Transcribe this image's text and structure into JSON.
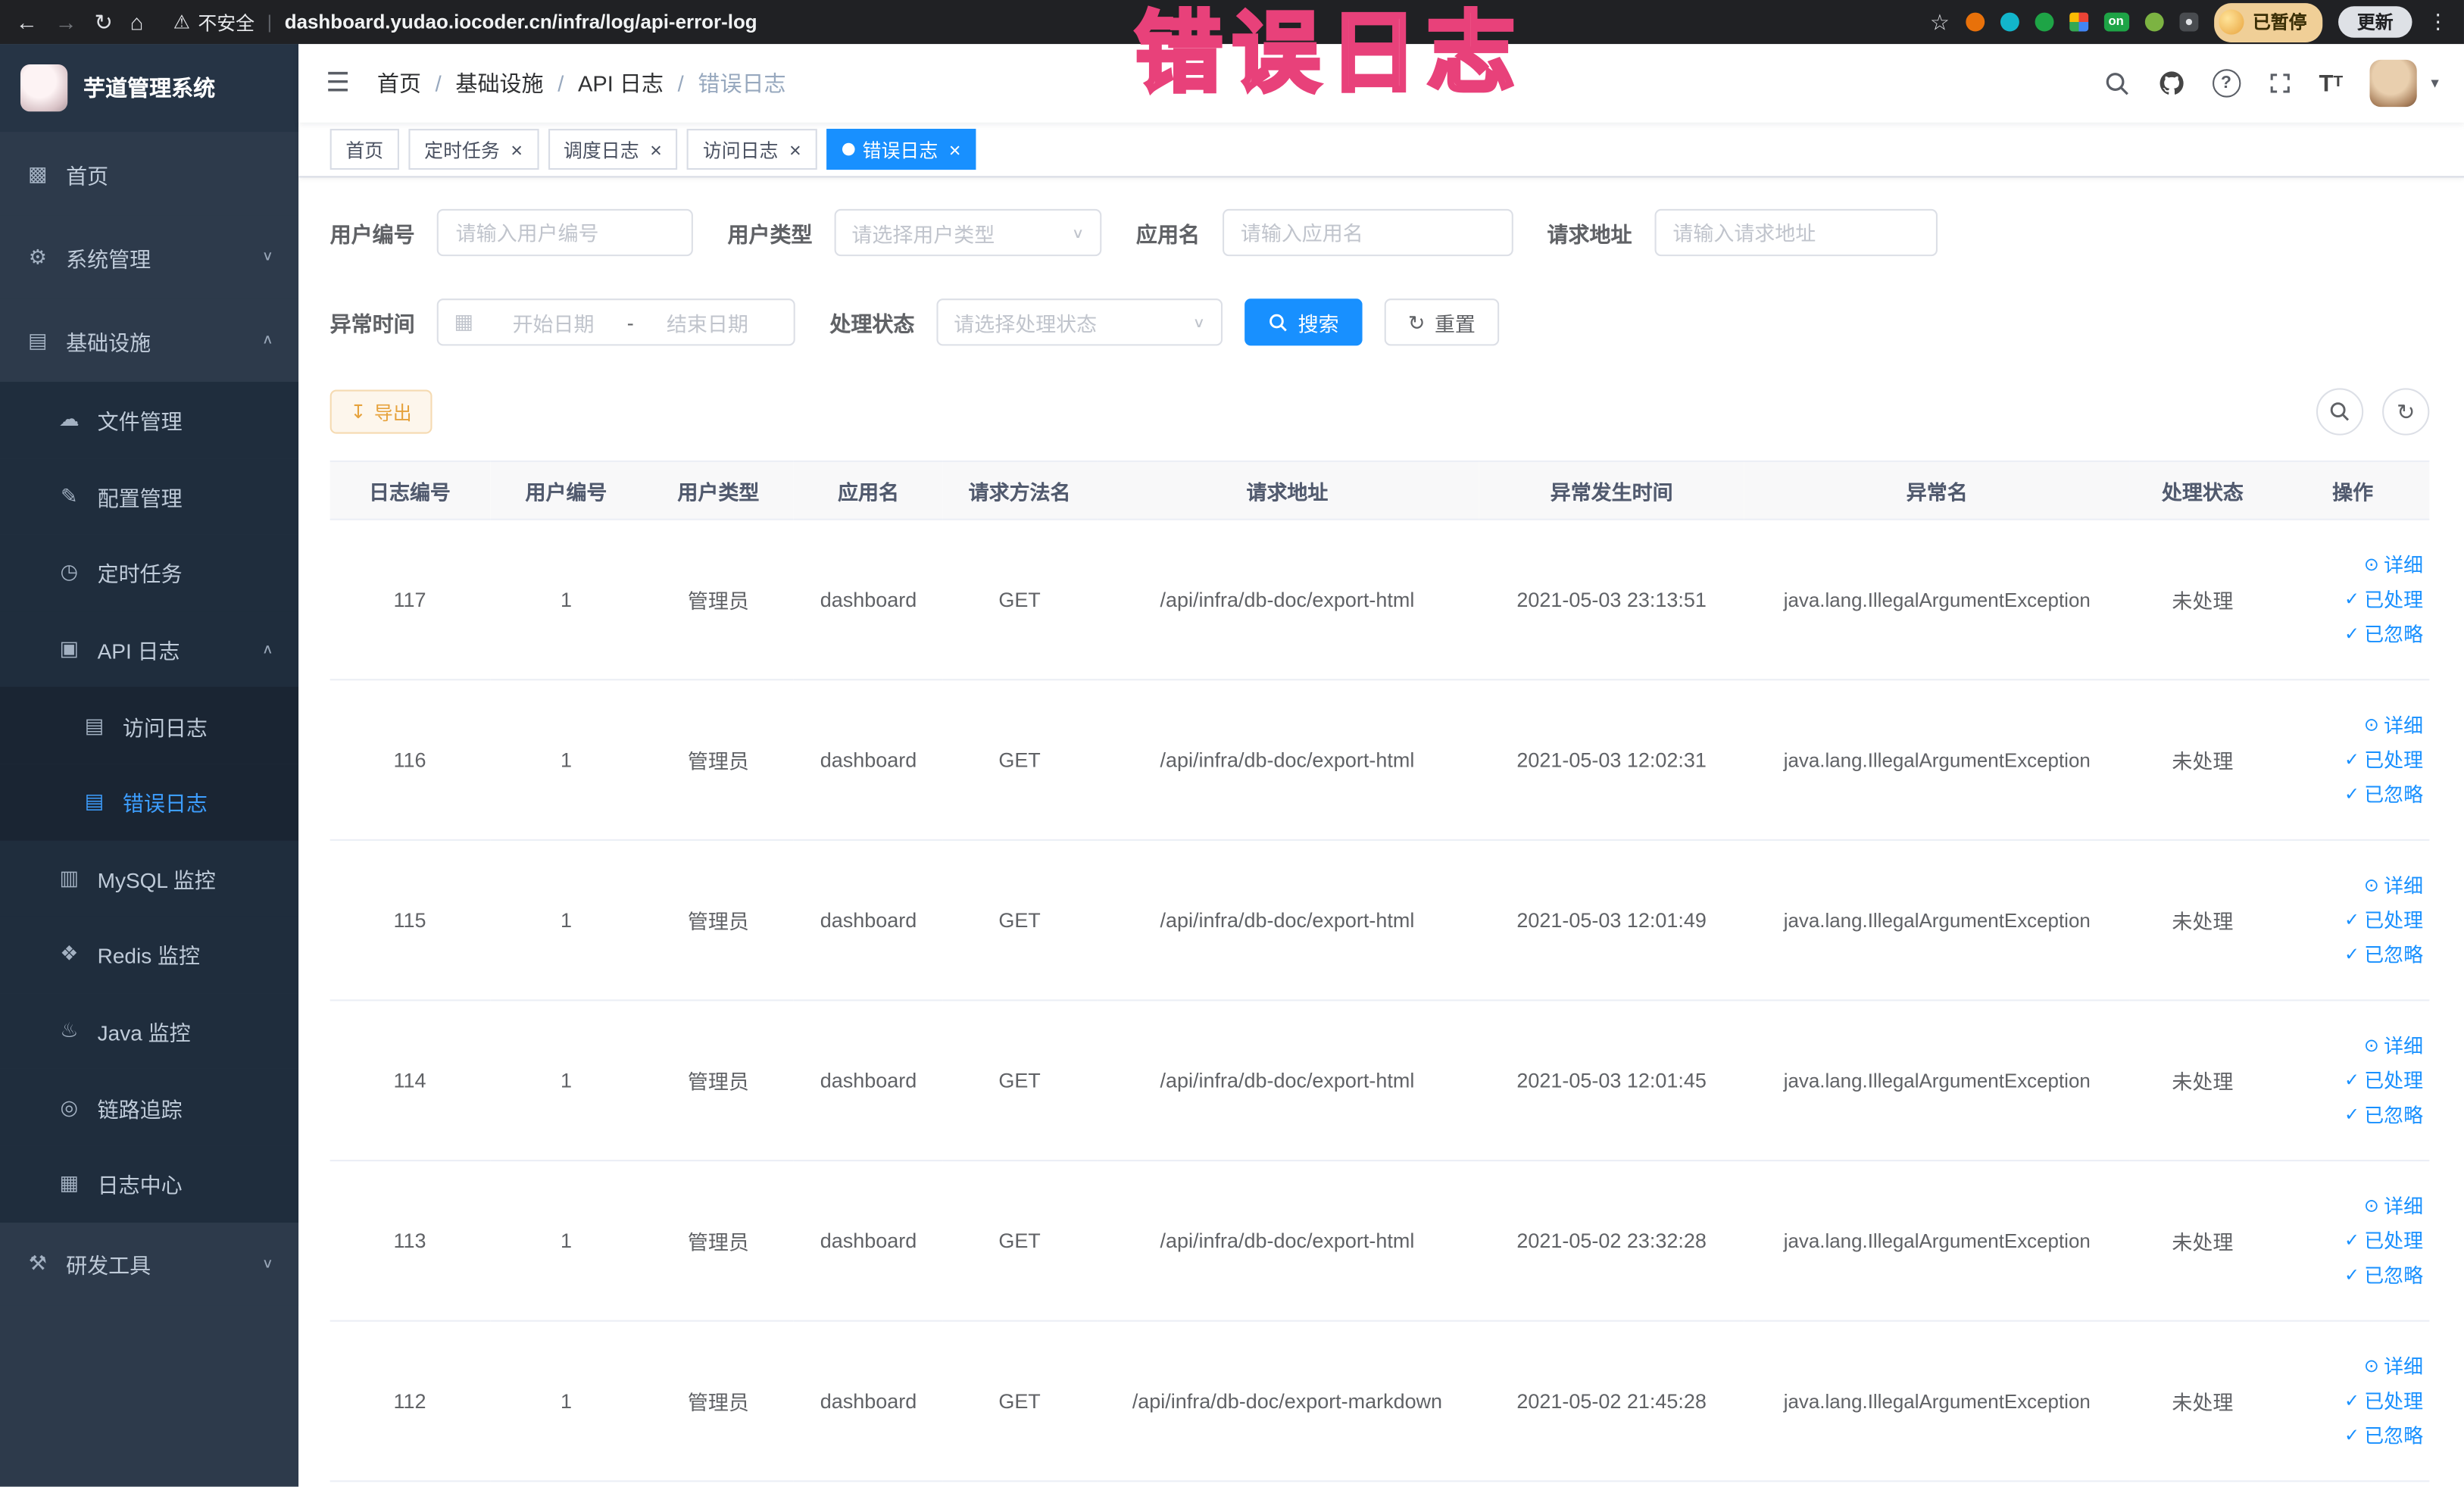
{
  "colors": {
    "accent": "#1890ff",
    "warning": "#e6a23c",
    "sidebar_bg": "#2d3a4b",
    "active_tab": "#1890ff"
  },
  "annotation": {
    "title": "错误日志"
  },
  "browser": {
    "security_label": "不安全",
    "url": "dashboard.yudao.iocoder.cn/infra/log/api-error-log",
    "extension_badge": "on",
    "profile_chip": "已暂停",
    "update_button": "更新"
  },
  "sidebar": {
    "logo_title": "芋道管理系统",
    "items": [
      {
        "name": "home",
        "label": "首页",
        "icon": "home-icon",
        "level": 0
      },
      {
        "name": "system-management",
        "label": "系统管理",
        "icon": "gear-icon",
        "level": 0,
        "chevron": "down"
      },
      {
        "name": "infrastructure",
        "label": "基础设施",
        "icon": "infrastructure-icon",
        "level": 0,
        "chevron": "up"
      },
      {
        "name": "file-management",
        "label": "文件管理",
        "icon": "cloud-icon",
        "level": 1
      },
      {
        "name": "config-management",
        "label": "配置管理",
        "icon": "edit-icon",
        "level": 1
      },
      {
        "name": "scheduled-jobs",
        "label": "定时任务",
        "icon": "timer-icon",
        "level": 1
      },
      {
        "name": "api-log",
        "label": "API 日志",
        "icon": "api-log-icon",
        "level": 1,
        "chevron": "up"
      },
      {
        "name": "access-log",
        "label": "访问日志",
        "icon": "access-log-icon",
        "level": 2
      },
      {
        "name": "error-log",
        "label": "错误日志",
        "icon": "error-log-icon",
        "level": 2,
        "active": true
      },
      {
        "name": "mysql-monitor",
        "label": "MySQL 监控",
        "icon": "mysql-icon",
        "level": 1
      },
      {
        "name": "redis-monitor",
        "label": "Redis 监控",
        "icon": "redis-icon",
        "level": 1
      },
      {
        "name": "java-monitor",
        "label": "Java 监控",
        "icon": "java-icon",
        "level": 1
      },
      {
        "name": "trace",
        "label": "链路追踪",
        "icon": "trace-icon",
        "level": 1
      },
      {
        "name": "log-center",
        "label": "日志中心",
        "icon": "log-center-icon",
        "level": 1
      },
      {
        "name": "dev-tools",
        "label": "研发工具",
        "icon": "tools-icon",
        "level": 0,
        "chevron": "down"
      }
    ]
  },
  "header": {
    "breadcrumb": [
      "首页",
      "基础设施",
      "API 日志",
      "错误日志"
    ]
  },
  "tabs": [
    {
      "name": "home",
      "label": "首页",
      "closable": false,
      "active": false
    },
    {
      "name": "job",
      "label": "定时任务",
      "closable": true,
      "active": false
    },
    {
      "name": "job-log",
      "label": "调度日志",
      "closable": true,
      "active": false
    },
    {
      "name": "access-log",
      "label": "访问日志",
      "closable": true,
      "active": false
    },
    {
      "name": "error-log",
      "label": "错误日志",
      "closable": true,
      "active": true
    }
  ],
  "filters": {
    "user_id": {
      "label": "用户编号",
      "placeholder": "请输入用户编号"
    },
    "user_type": {
      "label": "用户类型",
      "placeholder": "请选择用户类型"
    },
    "app_name": {
      "label": "应用名",
      "placeholder": "请输入应用名"
    },
    "request_url": {
      "label": "请求地址",
      "placeholder": "请输入请求地址"
    },
    "exception_time": {
      "label": "异常时间",
      "start_placeholder": "开始日期",
      "separator": "-",
      "end_placeholder": "结束日期"
    },
    "process_status": {
      "label": "处理状态",
      "placeholder": "请选择处理状态"
    },
    "search_button": "搜索",
    "reset_button": "重置"
  },
  "toolbar": {
    "export_button": "导出"
  },
  "table": {
    "columns": [
      "日志编号",
      "用户编号",
      "用户类型",
      "应用名",
      "请求方法名",
      "请求地址",
      "异常发生时间",
      "异常名",
      "处理状态",
      "操作"
    ],
    "row_actions": [
      {
        "name": "detail",
        "label": "详细",
        "icon": "view-icon"
      },
      {
        "name": "processed",
        "label": "已处理",
        "icon": "check-icon"
      },
      {
        "name": "ignored",
        "label": "已忽略",
        "icon": "check-icon"
      }
    ],
    "rows": [
      {
        "log_id": "117",
        "user_id": "1",
        "user_type": "管理员",
        "app_name": "dashboard",
        "method": "GET",
        "url": "/api/infra/db-doc/export-html",
        "time": "2021-05-03 23:13:51",
        "exception": "java.lang.IllegalArgumentException",
        "status": "未处理"
      },
      {
        "log_id": "116",
        "user_id": "1",
        "user_type": "管理员",
        "app_name": "dashboard",
        "method": "GET",
        "url": "/api/infra/db-doc/export-html",
        "time": "2021-05-03 12:02:31",
        "exception": "java.lang.IllegalArgumentException",
        "status": "未处理"
      },
      {
        "log_id": "115",
        "user_id": "1",
        "user_type": "管理员",
        "app_name": "dashboard",
        "method": "GET",
        "url": "/api/infra/db-doc/export-html",
        "time": "2021-05-03 12:01:49",
        "exception": "java.lang.IllegalArgumentException",
        "status": "未处理"
      },
      {
        "log_id": "114",
        "user_id": "1",
        "user_type": "管理员",
        "app_name": "dashboard",
        "method": "GET",
        "url": "/api/infra/db-doc/export-html",
        "time": "2021-05-03 12:01:45",
        "exception": "java.lang.IllegalArgumentException",
        "status": "未处理"
      },
      {
        "log_id": "113",
        "user_id": "1",
        "user_type": "管理员",
        "app_name": "dashboard",
        "method": "GET",
        "url": "/api/infra/db-doc/export-html",
        "time": "2021-05-02 23:32:28",
        "exception": "java.lang.IllegalArgumentException",
        "status": "未处理"
      },
      {
        "log_id": "112",
        "user_id": "1",
        "user_type": "管理员",
        "app_name": "dashboard",
        "method": "GET",
        "url": "/api/infra/db-doc/export-markdown",
        "time": "2021-05-02 21:45:28",
        "exception": "java.lang.IllegalArgumentException",
        "status": "未处理"
      }
    ]
  }
}
